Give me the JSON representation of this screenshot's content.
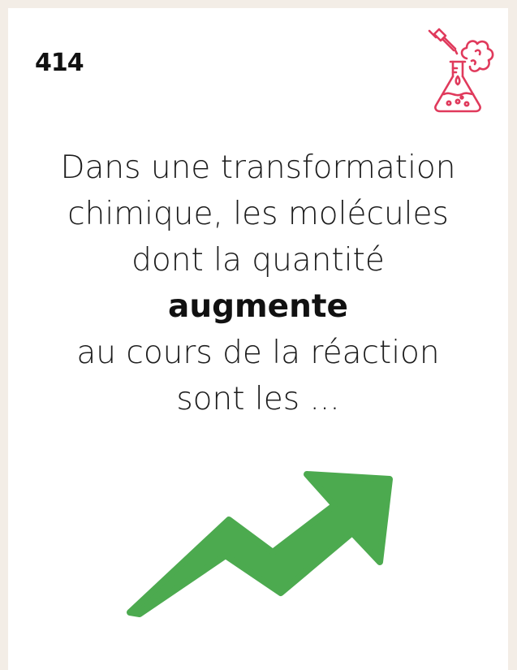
{
  "card": {
    "number": "414",
    "icon_name": "chemistry-flask-icon",
    "icon_color": "#e03a5c",
    "question_lines": [
      "Dans une transformation",
      "chimique, les molécules",
      "dont la quantité"
    ],
    "emphasis": "augmente",
    "question_lines_after": [
      "au cours de la réaction",
      "sont les ..."
    ],
    "arrow_icon_name": "trend-up-arrow-icon",
    "arrow_color": "#4caa4f",
    "background_color": "#f3ede6"
  }
}
